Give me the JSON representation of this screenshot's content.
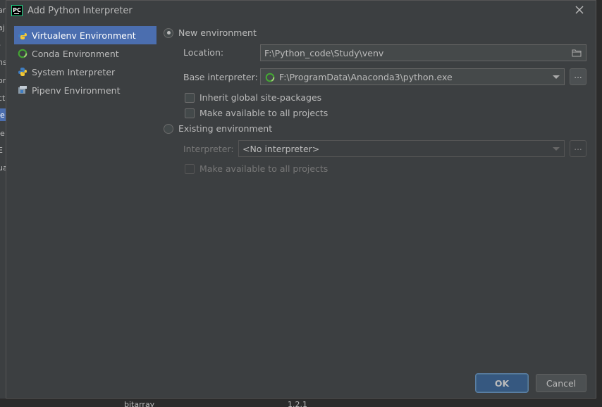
{
  "window": {
    "title": "Add Python Interpreter",
    "app_icon": "PC"
  },
  "background": {
    "strip_letters": [
      "ar",
      "aj",
      "-",
      "ns",
      "or",
      "ct",
      "je",
      "je",
      "E",
      "ua"
    ],
    "bottom_left": "bitarray",
    "bottom_right": "1.2.1"
  },
  "sidebar": {
    "items": [
      {
        "label": "Virtualenv Environment",
        "icon": "python-icon",
        "selected": true
      },
      {
        "label": "Conda Environment",
        "icon": "conda-icon",
        "selected": false
      },
      {
        "label": "System Interpreter",
        "icon": "python-icon",
        "selected": false
      },
      {
        "label": "Pipenv Environment",
        "icon": "pipenv-icon",
        "selected": false
      }
    ]
  },
  "new_env": {
    "radio_label": "New environment",
    "checked": true,
    "location_label": "Location:",
    "location_value": "F:\\Python_code\\Study\\venv",
    "base_label": "Base interpreter:",
    "base_value": "F:\\ProgramData\\Anaconda3\\python.exe",
    "browse_label": "...",
    "inherit_label": "Inherit global site-packages",
    "make_available_label": "Make available to all projects"
  },
  "existing_env": {
    "radio_label": "Existing environment",
    "checked": false,
    "interpreter_label": "Interpreter:",
    "interpreter_value": "<No interpreter>",
    "browse_label": "...",
    "make_available_label": "Make available to all projects"
  },
  "buttons": {
    "ok": "OK",
    "cancel": "Cancel"
  },
  "colors": {
    "selection": "#4b6eaf",
    "dialog_bg": "#3c3f41",
    "ok_button": "#365880"
  }
}
